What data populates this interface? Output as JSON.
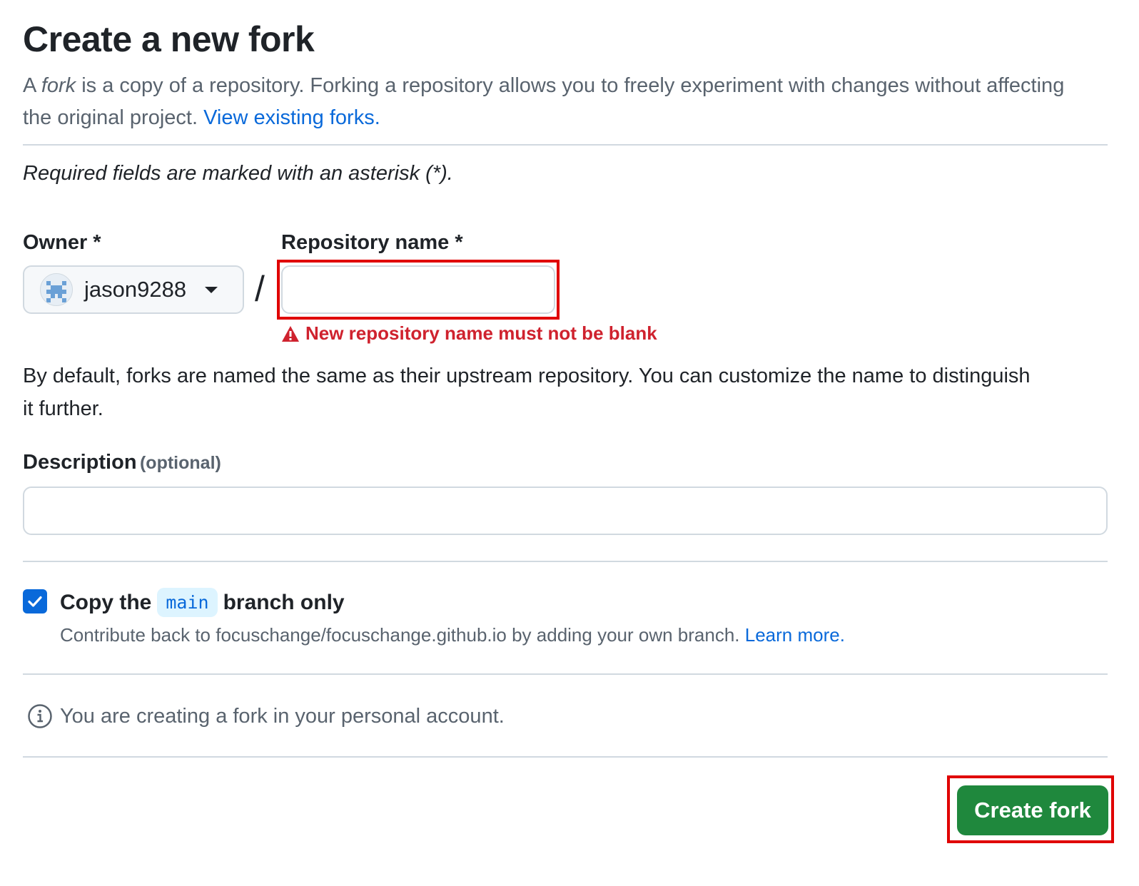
{
  "page": {
    "title": "Create a new fork",
    "intro_prefix": "A ",
    "intro_fork_word": "fork",
    "intro_rest": " is a copy of a repository. Forking a repository allows you to freely experiment with changes without affecting the original project. ",
    "intro_link": "View existing forks."
  },
  "form": {
    "required_note": "Required fields are marked with an asterisk (*).",
    "owner_label": "Owner *",
    "owner_value": "jason9288",
    "slash": "/",
    "repo_label": "Repository name *",
    "repo_value": "",
    "repo_error": "New repository name must not be blank",
    "repo_help": "By default, forks are named the same as their upstream repository. You can customize the name to distinguish it further.",
    "description_label": "Description",
    "description_optional": "(optional)",
    "description_value": ""
  },
  "copy_branch": {
    "checked": true,
    "label_prefix": "Copy the",
    "branch": "main",
    "label_suffix": "branch only",
    "sub_text": "Contribute back to focuschange/focuschange.github.io by adding your own branch. ",
    "sub_link": "Learn more."
  },
  "info": {
    "text": "You are creating a fork in your personal account."
  },
  "actions": {
    "create_label": "Create fork"
  },
  "colors": {
    "primary_button": "#1f883d",
    "link": "#0969da",
    "error": "#cf222e",
    "highlight": "#e00000"
  }
}
